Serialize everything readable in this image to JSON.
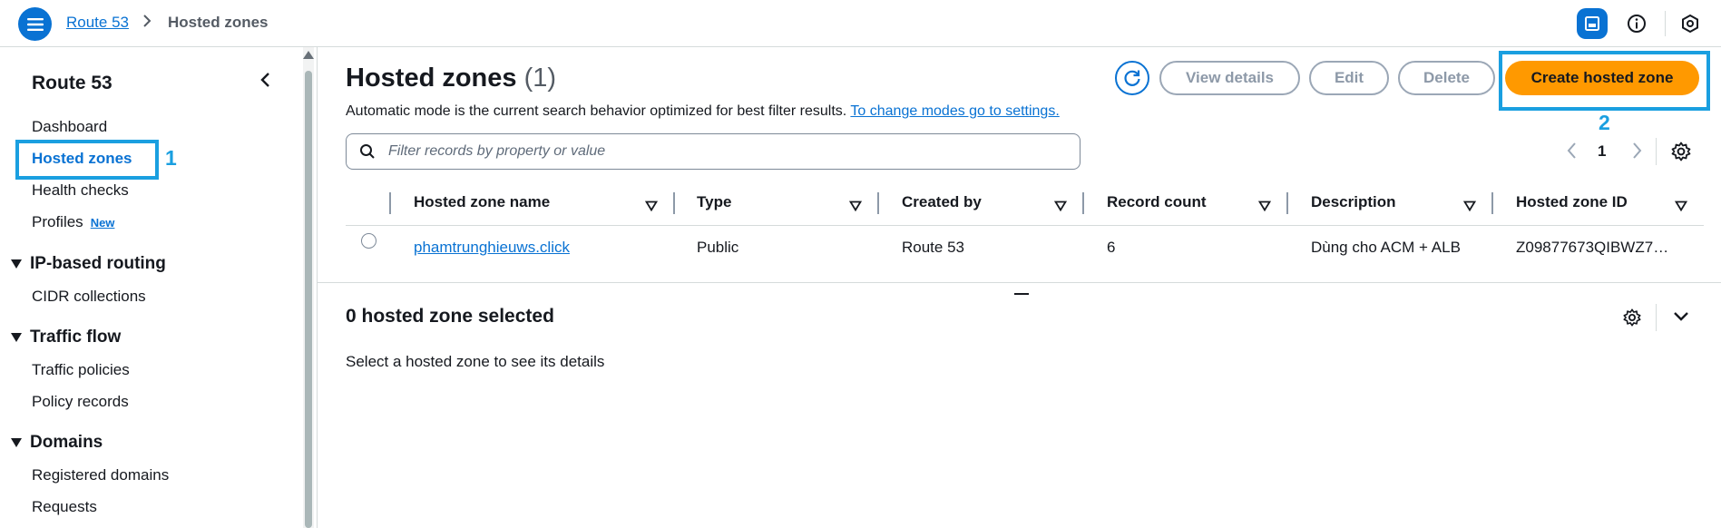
{
  "breadcrumb": {
    "root": "Route 53",
    "current": "Hosted zones"
  },
  "topbar_icons": [
    "menu-icon",
    "panel-icon",
    "info-icon",
    "settings-hex-icon"
  ],
  "sidebar": {
    "title": "Route 53",
    "items": [
      {
        "label": "Dashboard"
      },
      {
        "label": "Hosted zones",
        "active": true
      },
      {
        "label": "Health checks"
      },
      {
        "label": "Profiles",
        "badge": "New"
      }
    ],
    "sections": [
      {
        "title": "IP-based routing",
        "items": [
          "CIDR collections"
        ]
      },
      {
        "title": "Traffic flow",
        "items": [
          "Traffic policies",
          "Policy records"
        ]
      },
      {
        "title": "Domains",
        "items": [
          "Registered domains",
          "Requests"
        ]
      }
    ]
  },
  "annotations": {
    "one": "1",
    "two": "2"
  },
  "main": {
    "title": "Hosted zones",
    "count": "(1)",
    "subtitle": "Automatic mode is the current search behavior optimized for best filter results.",
    "subtitle_link": "To change modes go to settings.",
    "buttons": {
      "view_details": "View details",
      "edit": "Edit",
      "delete": "Delete",
      "create": "Create hosted zone"
    },
    "search_placeholder": "Filter records by property or value",
    "page": "1",
    "columns": [
      "Hosted zone name",
      "Type",
      "Created by",
      "Record count",
      "Description",
      "Hosted zone ID"
    ],
    "rows": [
      {
        "name": "phamtrunghieuws.click",
        "type": "Public",
        "created_by": "Route 53",
        "record_count": "6",
        "description": "Dùng cho ACM + ALB",
        "zone_id": "Z09877673QIBWZ7…"
      }
    ]
  },
  "details": {
    "title": "0 hosted zone selected",
    "text": "Select a hosted zone to see its details"
  },
  "colors": {
    "accent": "#0972d3",
    "primary_button": "#ff9900",
    "annotation": "#1a9fe0"
  }
}
